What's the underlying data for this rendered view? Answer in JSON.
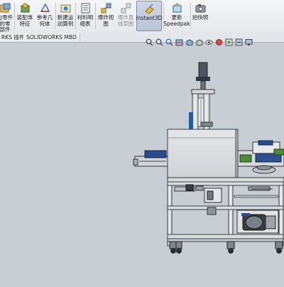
{
  "ribbon": {
    "buttons": [
      {
        "id": "make-part",
        "label": "为零件\n的零\n部件",
        "icon": "part-from-assembly-icon"
      },
      {
        "id": "assembly-feature",
        "label": "装配体\n特征",
        "icon": "assembly-feature-icon"
      },
      {
        "id": "reference-geometry",
        "label": "参考几\n何体",
        "icon": "reference-geometry-icon"
      },
      {
        "id": "new-motion-study",
        "label": "新建运\n动算例",
        "icon": "motion-study-icon"
      },
      {
        "id": "bom",
        "label": "材料明\n细表",
        "icon": "bill-of-materials-icon"
      },
      {
        "id": "exploded-view",
        "label": "爆炸视\n图",
        "icon": "exploded-view-icon"
      },
      {
        "id": "explode-line-sketch",
        "label": "爆炸直\n线草图",
        "icon": "explode-line-sketch-icon",
        "disabled": true
      },
      {
        "id": "instant3d",
        "label": "Instant3D",
        "icon": "instant3d-icon",
        "active": true
      },
      {
        "id": "update-speedpak",
        "label": "更新\nSpeedpak",
        "icon": "speedpak-icon"
      },
      {
        "id": "snapshot",
        "label": "拍快照",
        "icon": "camera-snapshot-icon"
      }
    ]
  },
  "tabs": [
    {
      "label": "RKS 插件"
    },
    {
      "label": "SOLIDWORKS MBD"
    }
  ],
  "hud": {
    "icons": [
      "zoom-to-fit-icon",
      "zoom-area-icon",
      "previous-view-icon",
      "section-view-icon",
      "view-orientation-icon",
      "display-style-icon",
      "hide-show-icon",
      "appearance-icon",
      "scene-icon",
      "view-settings-icon",
      "monitor-icon"
    ]
  },
  "colors": {
    "viewport_bg": "#c9ced4",
    "machine_steel": "#d9dcdf",
    "green_part": "#4e8a3c",
    "blue_belt": "#2a4a8c",
    "motor_dark": "#3a3e44"
  }
}
